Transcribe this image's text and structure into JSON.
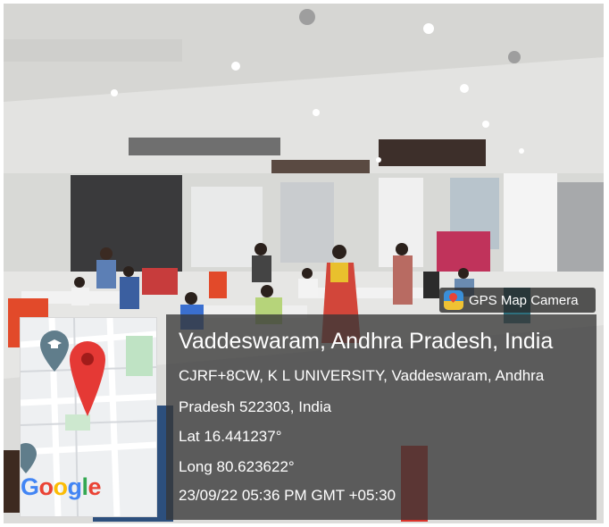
{
  "overlay": {
    "app_name": "GPS Map Camera",
    "location_title": "Vaddeswaram, Andhra Pradesh, India",
    "address_line1": "CJRF+8CW, K L UNIVERSITY, Vaddeswaram, Andhra",
    "address_line2": "Pradesh 522303, India",
    "latitude": "Lat 16.441237°",
    "longitude": "Long 80.623622°",
    "datetime": "23/09/22 05:36 PM GMT +05:30"
  },
  "map": {
    "brand_letters": [
      {
        "ch": "G",
        "color": "#4285F4"
      },
      {
        "ch": "o",
        "color": "#EA4335"
      },
      {
        "ch": "o",
        "color": "#FBBC05"
      },
      {
        "ch": "g",
        "color": "#4285F4"
      },
      {
        "ch": "l",
        "color": "#34A853"
      },
      {
        "ch": "e",
        "color": "#EA4335"
      }
    ],
    "pin_colors": {
      "primary": "#e53935",
      "secondary": "#607d8b"
    }
  },
  "icons": {
    "app_logo": "gps-map-camera-logo-icon",
    "red_marker": "map-pin-icon",
    "grey_marker": "education-pin-icon"
  }
}
